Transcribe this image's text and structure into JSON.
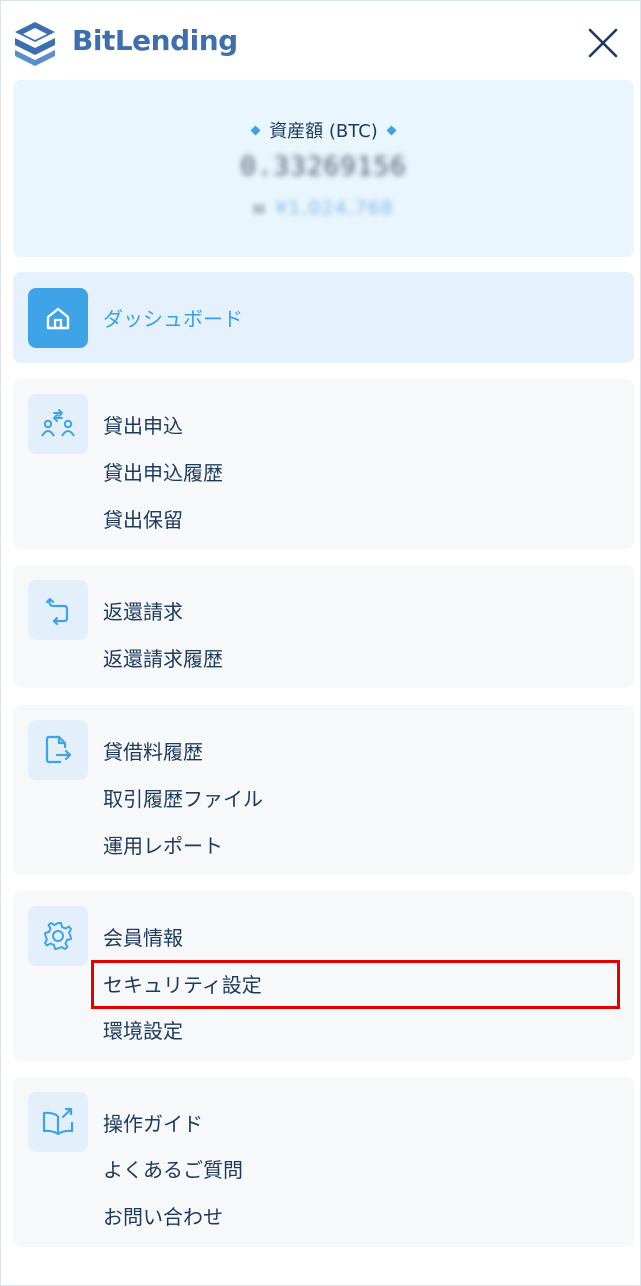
{
  "header": {
    "brand": "BitLending",
    "close_icon": "close-icon"
  },
  "balance": {
    "label": "資産額 (BTC)",
    "btc_value": "0.33269156",
    "jpy_value": "¥1,024,768"
  },
  "nav": {
    "dashboard": {
      "icon": "home-icon",
      "label": "ダッシュボード"
    },
    "lending": {
      "icon": "lending-exchange-icon",
      "items": [
        "貸出申込",
        "貸出申込履歴",
        "貸出保留"
      ]
    },
    "return": {
      "icon": "return-icon",
      "items": [
        "返還請求",
        "返還請求履歴"
      ]
    },
    "reports": {
      "icon": "file-export-icon",
      "items": [
        "貸借料履歴",
        "取引履歴ファイル",
        "運用レポート"
      ]
    },
    "account": {
      "icon": "gear-icon",
      "items": [
        "会員情報",
        "セキュリティ設定",
        "環境設定"
      ]
    },
    "support": {
      "icon": "book-share-icon",
      "items": [
        "操作ガイド",
        "よくあるご質問",
        "お問い合わせ"
      ]
    }
  },
  "colors": {
    "brand": "#3d6fae",
    "accent": "#3fa3e8",
    "text": "#1c3a5e",
    "highlight": "#e50000"
  }
}
